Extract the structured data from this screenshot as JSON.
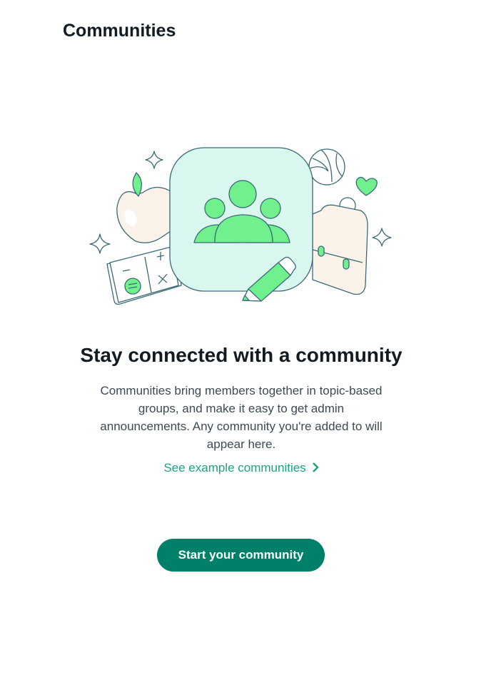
{
  "header": {
    "title": "Communities"
  },
  "empty_state": {
    "heading": "Stay connected with a community",
    "description": "Communities bring members together in topic-based groups, and make it easy to get admin announcements. Any community you're added to will appear here.",
    "link_label": "See example communities",
    "button_label": "Start your community"
  },
  "colors": {
    "accent": "#008069",
    "link": "#1aa37f",
    "illustration_green": "#71f08e",
    "illustration_bg": "#d9f6ef",
    "stroke": "#3b6a78"
  }
}
